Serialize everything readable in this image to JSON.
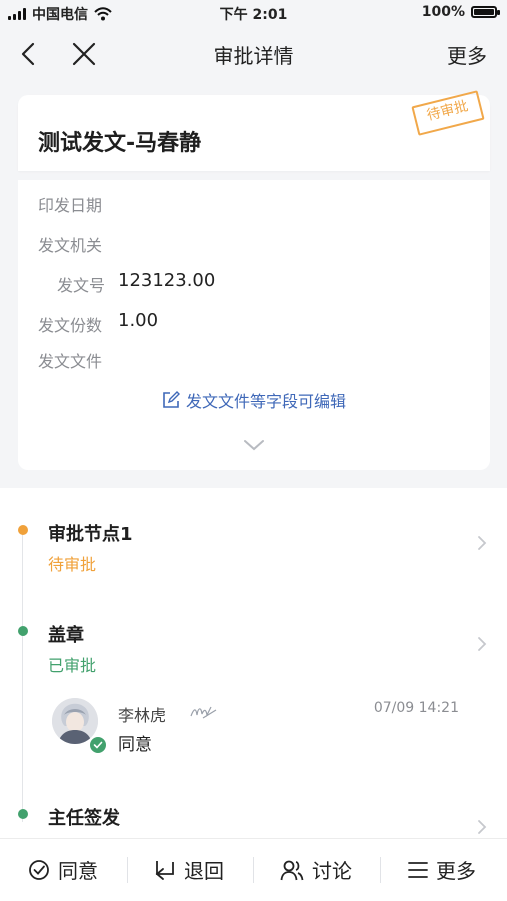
{
  "statusbar": {
    "carrier": "中国电信",
    "time": "下午 2:01",
    "battery": "100%"
  },
  "navbar": {
    "title": "审批详情",
    "more": "更多",
    "back_icon": "back-icon",
    "close_icon": "close-icon"
  },
  "document": {
    "title": "测试发文-马春静",
    "status_stamp": "待审批",
    "fields": [
      {
        "label": "印发日期",
        "value": ""
      },
      {
        "label": "发文机关",
        "value": ""
      },
      {
        "label": "发文号",
        "value": "123123.00"
      },
      {
        "label": "发文份数",
        "value": "1.00"
      },
      {
        "label": "发文文件",
        "value": ""
      }
    ],
    "edit_hint": "发文文件等字段可编辑"
  },
  "flow": {
    "nodes": [
      {
        "title": "审批节点1",
        "status": "待审批",
        "status_color": "#f0a13a",
        "dot_color": "#f0a13a"
      },
      {
        "title": "盖章",
        "status": "已审批",
        "status_color": "#42a16d",
        "dot_color": "#42a16d"
      },
      {
        "title": "主任签发",
        "status": "",
        "status_color": "#8b8d92",
        "dot_color": "#42a16d"
      }
    ],
    "approval": {
      "name": "李林虎",
      "time": "07/09 14:21",
      "comment": "同意"
    }
  },
  "tabbar": {
    "approve": "同意",
    "reject": "退回",
    "discuss": "讨论",
    "more": "更多"
  },
  "colors": {
    "accent": "#3f68b8",
    "pending": "#f0a13a",
    "approved": "#42a16d"
  }
}
